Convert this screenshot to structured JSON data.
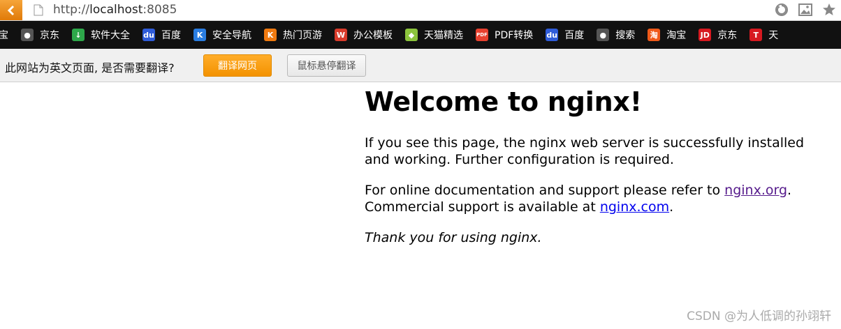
{
  "browser": {
    "url_scheme": "http://",
    "url_host": "localhost",
    "url_port": ":8085",
    "icons": {
      "back": "back-arrow-icon",
      "page": "page-icon",
      "refresh": "refresh-icon",
      "screenshot": "image-icon",
      "favorite": "star-icon"
    }
  },
  "bookmarks": {
    "items": [
      {
        "label": "宝",
        "icon": "taobao-icon",
        "color": "#111111"
      },
      {
        "label": "京东",
        "icon": "globe-icon",
        "color": "#555555"
      },
      {
        "label": "软件大全",
        "icon": "download-icon",
        "color": "#2ea84a"
      },
      {
        "label": "百度",
        "icon": "baidu-icon",
        "color": "#2f5cd9"
      },
      {
        "label": "安全导航",
        "icon": "k-icon",
        "color": "#2a7de1"
      },
      {
        "label": "热门页游",
        "icon": "k-game-icon",
        "color": "#f07a10"
      },
      {
        "label": "办公模板",
        "icon": "template-icon",
        "color": "#d93b2b"
      },
      {
        "label": "天猫精选",
        "icon": "leaf-icon",
        "color": "#8cc43c"
      },
      {
        "label": "PDF转换",
        "icon": "pdf-icon",
        "color": "#e8412f"
      },
      {
        "label": "百度",
        "icon": "baidu-icon",
        "color": "#2f5cd9"
      },
      {
        "label": "搜索",
        "icon": "globe-icon",
        "color": "#555555"
      },
      {
        "label": "淘宝",
        "icon": "taobao-icon",
        "color": "#f05a1a"
      },
      {
        "label": "京东",
        "icon": "jd-icon",
        "color": "#d71920"
      },
      {
        "label": "天",
        "icon": "tmall-icon",
        "color": "#d71920"
      }
    ]
  },
  "translate_bar": {
    "prompt": "此网站为英文页面, 是否需要翻译?",
    "translate_label": "翻译网页",
    "hover_label": "鼠标悬停翻译"
  },
  "page": {
    "heading": "Welcome to nginx!",
    "p1": "If you see this page, the nginx web server is successfully installed and working. Further configuration is required.",
    "p2_pre": "For online documentation and support please refer to ",
    "link1": "nginx.org",
    "p2_mid": ".",
    "p2_line2": "Commercial support is available at ",
    "link2": "nginx.com",
    "p2_end": ".",
    "p3": "Thank you for using nginx."
  },
  "watermark": "CSDN @为人低调的孙翊轩"
}
